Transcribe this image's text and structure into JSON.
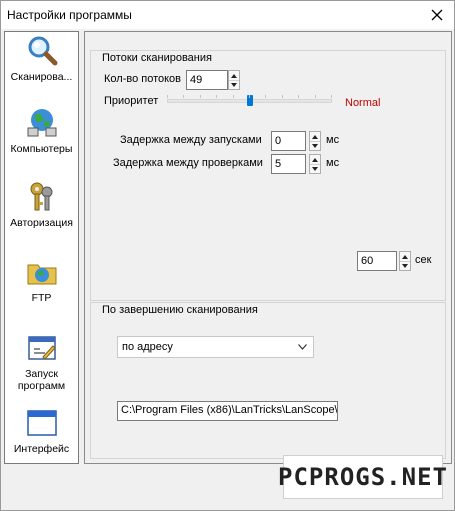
{
  "window": {
    "title": "Настройки программы"
  },
  "sidebar": {
    "items": [
      {
        "label": "Сканирова..."
      },
      {
        "label": "Компьютеры"
      },
      {
        "label": "Авторизация"
      },
      {
        "label": "FTP"
      },
      {
        "label": "Запуск\nпрограмм"
      },
      {
        "label": "Интерфейс"
      }
    ]
  },
  "scan": {
    "group_title": "Потоки сканирования",
    "threads_label": "Кол-во потоков",
    "threads_value": "49",
    "priority_label": "Приоритет",
    "priority_value": "Normal",
    "priority_level": 0.5,
    "launch_delay_label": "Задержка между запусками",
    "launch_delay_value": "0",
    "check_delay_label": "Задержка между проверками",
    "check_delay_value": "5",
    "ms_unit": "мс",
    "timeout_value": "60",
    "sec_unit": "сек"
  },
  "finish": {
    "group_title": "По завершению сканирования",
    "sort_selected": "по адресу",
    "path_value": "C:\\Program Files (x86)\\LanTricks\\LanScope\\"
  },
  "watermark": "PCPROGS.NET",
  "colors": {
    "thumb": "#0078d7",
    "normal": "#c00000"
  }
}
